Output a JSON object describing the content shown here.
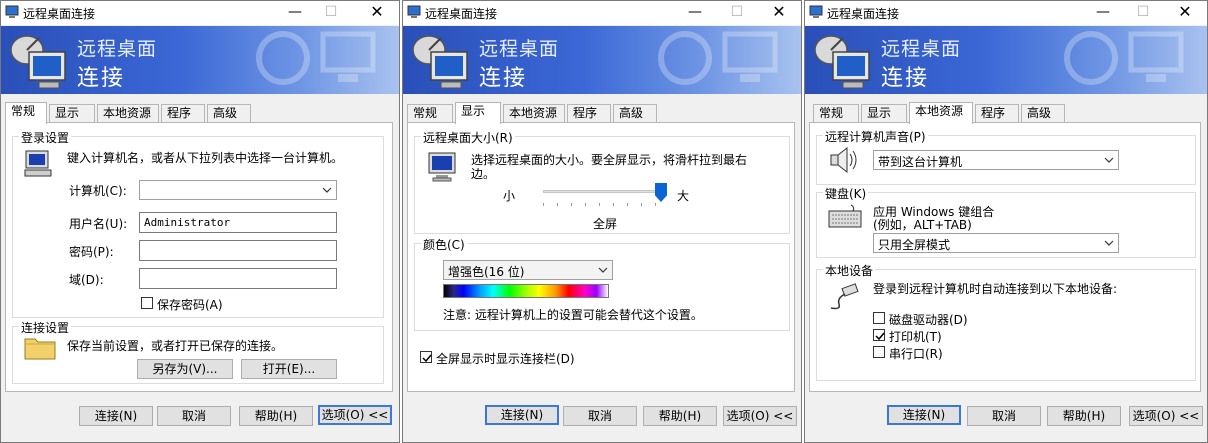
{
  "title": "远程桌面连接",
  "banner": {
    "line1": "远程桌面",
    "line2": "连接"
  },
  "tabs": [
    "常规",
    "显示",
    "本地资源",
    "程序",
    "高级"
  ],
  "footer": {
    "connect": "连接(N)",
    "cancel": "取消",
    "help": "帮助(H)",
    "options": "选项(O) <<"
  },
  "general": {
    "login_group": "登录设置",
    "login_desc": "键入计算机名，或者从下拉列表中选择一台计算机。",
    "computer_label": "计算机(C):",
    "computer_value": "",
    "username_label": "用户名(U):",
    "username_value": "Administrator",
    "password_label": "密码(P):",
    "domain_label": "域(D):",
    "save_password": "保存密码(A)",
    "conn_group": "连接设置",
    "conn_desc": "保存当前设置，或者打开已保存的连接。",
    "save_as": "另存为(V)...",
    "open": "打开(E)..."
  },
  "display": {
    "size_group": "远程桌面大小(R)",
    "size_desc_1": "选择远程桌面的大小。要全屏显示，将滑杆拉到最右",
    "size_desc_2": "边。",
    "small": "小",
    "large": "大",
    "fullscreen": "全屏",
    "slider_value": 1.0,
    "color_group": "颜色(C)",
    "color_value": "增强色(16 位)",
    "note": "注意: 远程计算机上的设置可能会替代这个设置。",
    "show_bar": "全屏显示时显示连接栏(D)",
    "show_bar_checked": true
  },
  "local": {
    "sound_group": "远程计算机声音(P)",
    "sound_value": "带到这台计算机",
    "keyboard_group": "键盘(K)",
    "keyboard_desc_1": "应用 Windows 键组合",
    "keyboard_desc_2": "(例如，ALT+TAB)",
    "keyboard_value": "只用全屏模式",
    "devices_group": "本地设备",
    "devices_desc": "登录到远程计算机时自动连接到以下本地设备:",
    "disk": "磁盘驱动器(D)",
    "printer": "打印机(T)",
    "serial": "串行口(R)",
    "disk_checked": false,
    "printer_checked": true,
    "serial_checked": false
  },
  "colors": {
    "banner_start": "#2a4fb8",
    "banner_end": "#a9c2ef",
    "focus": "#3b79d8"
  }
}
